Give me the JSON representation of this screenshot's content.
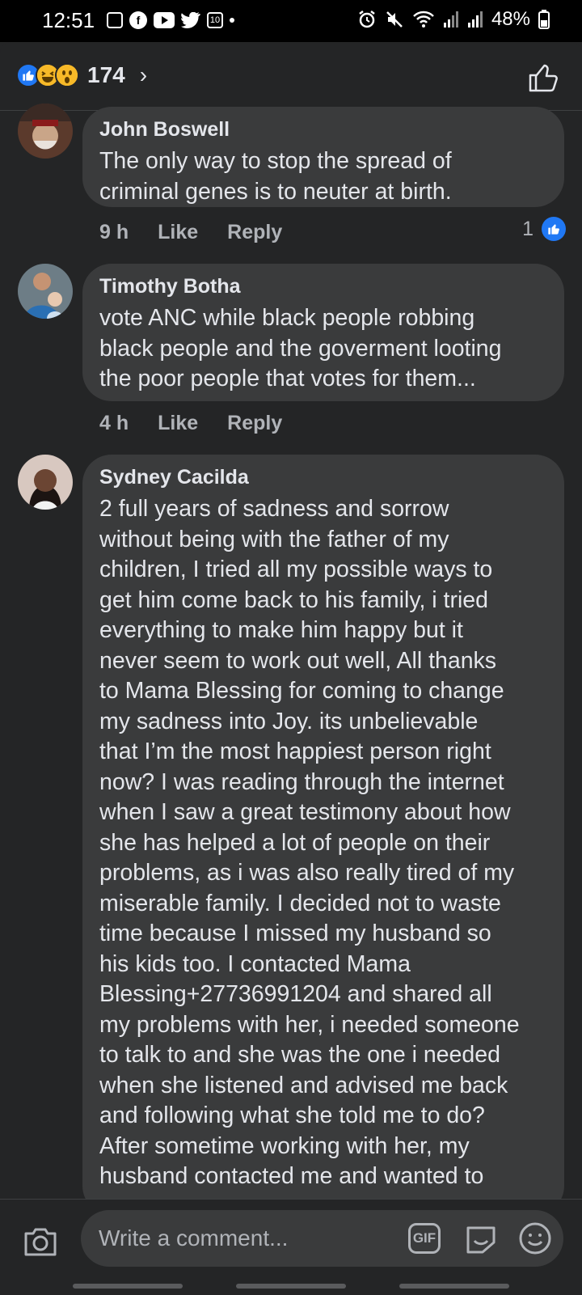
{
  "status_bar": {
    "time": "12:51",
    "left_icons": [
      "sim-icon",
      "facebook-icon",
      "youtube-icon",
      "twitter-icon",
      "badge-10-icon",
      "dot-icon"
    ],
    "badge_text": "10",
    "right_icons": [
      "alarm-icon",
      "mute-icon",
      "wifi-icon",
      "signal-icon",
      "signal-icon",
      "battery-icon"
    ],
    "battery": "48%"
  },
  "header": {
    "reaction_icons": [
      "like-reaction-icon",
      "haha-reaction-icon",
      "wow-reaction-icon"
    ],
    "reaction_count": "174",
    "chevron": "›"
  },
  "comments": [
    {
      "author": "John Boswell",
      "text": "The only way to stop the spread of\ncriminal genes is to neuter at birth.",
      "time": "9 h",
      "like_label": "Like",
      "reply_label": "Reply",
      "likes": "1"
    },
    {
      "author": "Timothy Botha",
      "text": "vote ANC while black people robbing\nblack people and the goverment looting\nthe poor people that votes for them...",
      "time": "4 h",
      "like_label": "Like",
      "reply_label": "Reply"
    },
    {
      "author": "Sydney Cacilda",
      "text": "2 full years of sadness and sorrow\nwithout being with the father of my\nchildren, I tried all my possible ways to\nget him come back to his family, i tried\neverything to make him happy but it\nnever seem to work out well, All thanks\nto Mama Blessing for coming to change\nmy sadness into Joy. its unbelievable\nthat I’m the most happiest person right\nnow? I was reading through the internet\nwhen I saw a great testimony about how\nshe has helped a lot of people on their\nproblems, as i was also really tired of my\nmiserable family. I decided not to waste\ntime because I missed my husband so\nhis kids too. I contacted Mama\nBlessing+27736991204 and shared all\nmy problems with her, i needed someone\nto talk to and she was the one i needed\nwhen she listened and advised me back\nand following what she told me to do?\nAfter sometime working with her, my\nhusband contacted me and wanted to"
    }
  ],
  "composer": {
    "placeholder": "Write a comment...",
    "gif_label": "GIF"
  },
  "colors": {
    "background": "#242526",
    "bubble": "#3a3b3c",
    "text": "#e4e6eb",
    "secondary_text": "#b0b3b8",
    "accent": "#2078f4"
  }
}
